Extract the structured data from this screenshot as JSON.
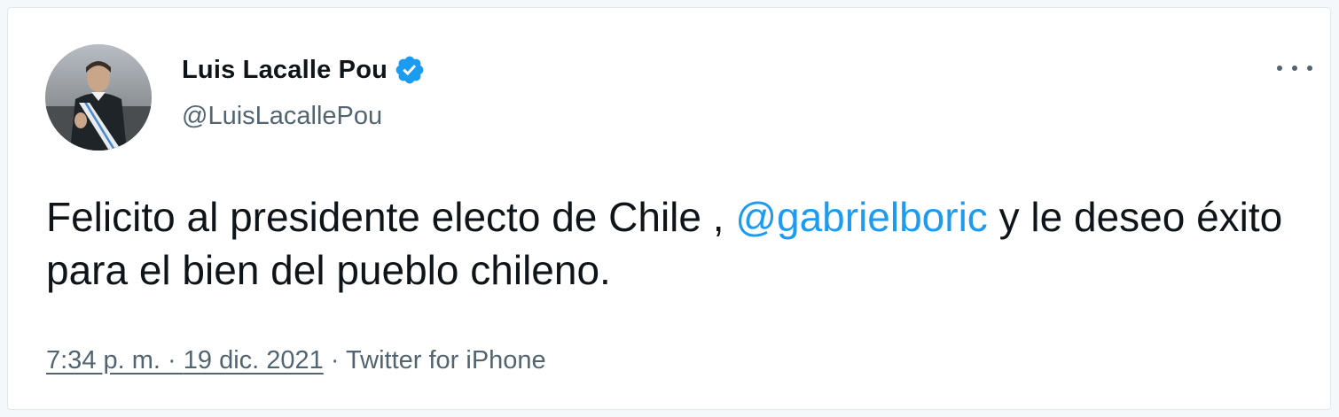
{
  "author": {
    "display_name": "Luis Lacalle Pou",
    "handle": "@LuisLacallePou",
    "verified": true,
    "verified_icon": "verified-badge-icon",
    "avatar_icon": "profile-photo"
  },
  "tweet": {
    "text_before_mention": "Felicito al presidente electo de Chile , ",
    "mention": "@gabrielboric",
    "text_after_mention": " y le deseo éxito para el bien del pueblo chileno."
  },
  "meta": {
    "time": "7:34 p. m.",
    "separator1": " · ",
    "date": "19 dic. 2021",
    "separator2": " · ",
    "source": "Twitter for iPhone"
  },
  "menu": {
    "icon": "more-options-icon"
  },
  "colors": {
    "accent": "#1d9bf0",
    "text_primary": "#0f1419",
    "text_secondary": "#536471"
  }
}
